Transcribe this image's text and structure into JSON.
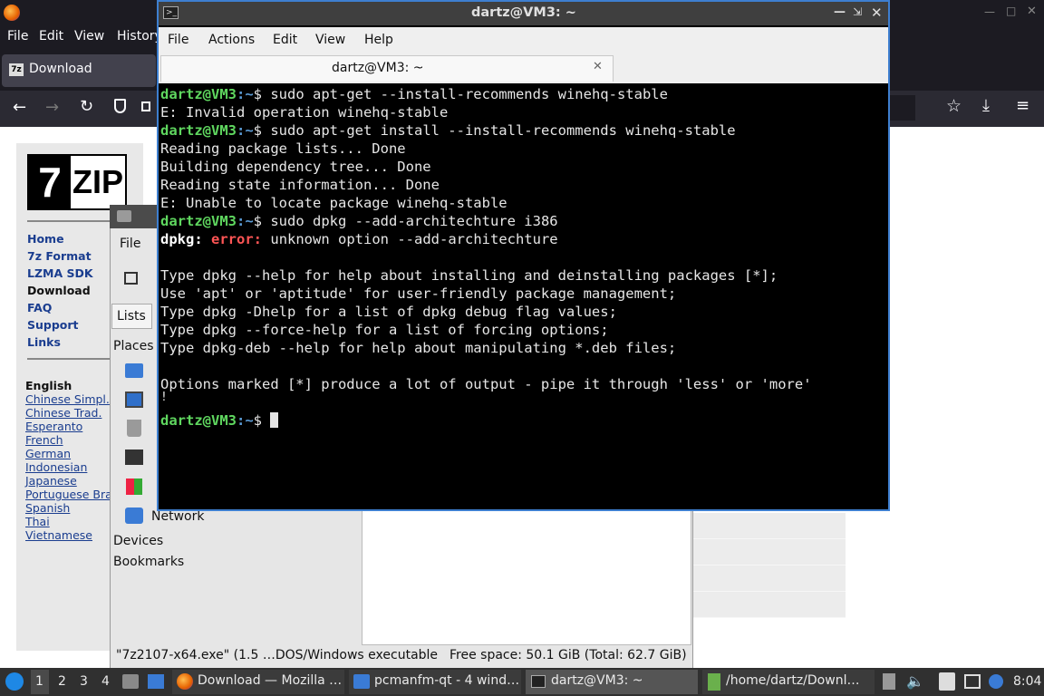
{
  "firefox": {
    "menu": [
      "File",
      "Edit",
      "View",
      "History"
    ],
    "tab_label": "Download"
  },
  "sevenzip": {
    "logo_text": "7ZIP",
    "nav": [
      "Home",
      "7z Format",
      "LZMA SDK",
      "Download",
      "FAQ",
      "Support",
      "Links"
    ],
    "current_lang": "English",
    "languages": [
      "Chinese Simpl.",
      "Chinese Trad.",
      "Esperanto",
      "French",
      "German",
      "Indonesian",
      "Japanese",
      "Portuguese Braz",
      "Spanish",
      "Thai",
      "Vietnamese"
    ]
  },
  "filemanager": {
    "menu_file": "File",
    "lists_tab": "Lists",
    "places_label": "Places",
    "network_label": "Network",
    "devices_label": "Devices",
    "bookmarks_label": "Bookmarks",
    "status_file": "\"7z2107-x64.exe\" (1.5 …DOS/Windows executable",
    "status_free": "Free space: 50.1 GiB (Total: 62.7 GiB)"
  },
  "terminal": {
    "title": "dartz@VM3: ~",
    "menu": [
      "File",
      "Actions",
      "Edit",
      "View",
      "Help"
    ],
    "tab_label": "dartz@VM3: ~",
    "prompt_user": "dartz@VM3",
    "prompt_path": ":~",
    "prompt_symbol": "$ ",
    "cmd1": "sudo apt-get --install-recommends winehq-stable",
    "out1": "E: Invalid operation winehq-stable",
    "cmd2": "sudo apt-get install --install-recommends winehq-stable",
    "out2": "Reading package lists... Done",
    "out3": "Building dependency tree... Done",
    "out4": "Reading state information... Done",
    "out5": "E: Unable to locate package winehq-stable",
    "cmd3": "sudo dpkg --add-architechture i386",
    "dpkg_label": "dpkg:",
    "error_label": "error:",
    "err_msg": "unknown option --add-architechture",
    "help1": "Type dpkg --help for help about installing and deinstalling packages [*];",
    "help2": "Use 'apt' or 'aptitude' for user-friendly package management;",
    "help3": "Type dpkg -Dhelp for a list of dpkg debug flag values;",
    "help4": "Type dpkg --force-help for a list of forcing options;",
    "help5": "Type dpkg-deb --help for help about manipulating *.deb files;",
    "help6": "Options marked [*] produce a lot of output - pipe it through 'less' or 'more'",
    "stray": "!"
  },
  "taskbar": {
    "desktops": [
      "1",
      "2",
      "3",
      "4"
    ],
    "tasks": [
      "Download — Mozilla …",
      "pcmanfm-qt - 4 wind…",
      "dartz@VM3: ~",
      "/home/dartz/Downl…"
    ],
    "clock": "8:04"
  }
}
